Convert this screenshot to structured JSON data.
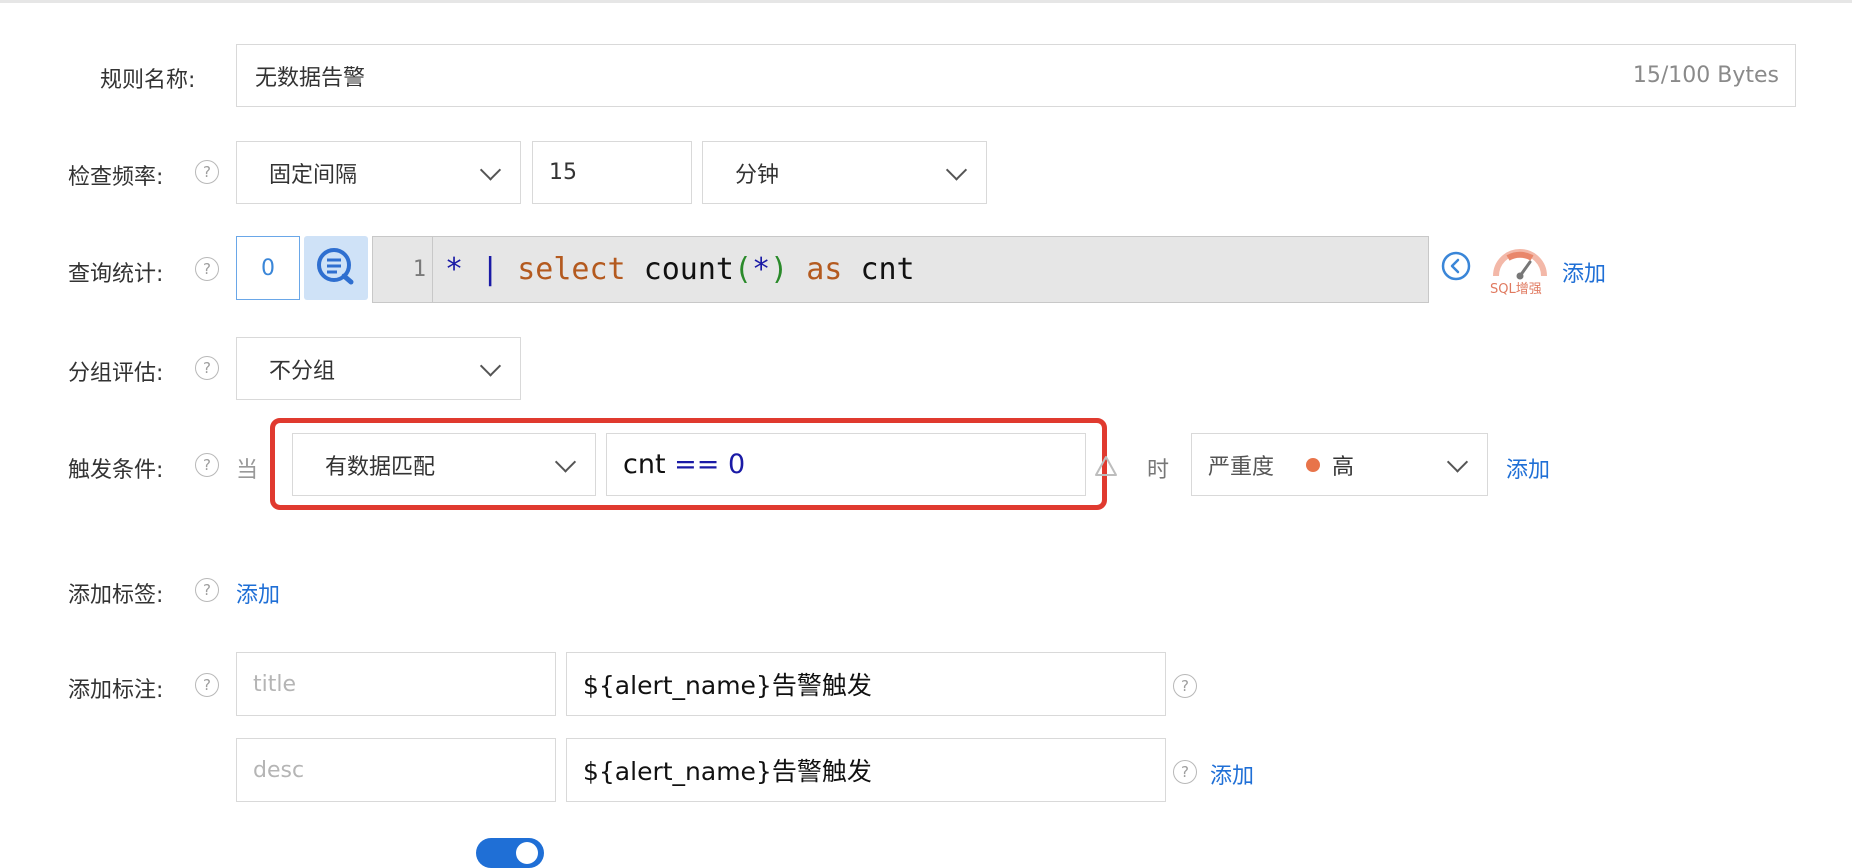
{
  "rule_name": {
    "label": "规则名称:",
    "value": "无数据告警",
    "counter": "15/100 Bytes"
  },
  "check_frequency": {
    "label": "检查频率:",
    "mode": "固定间隔",
    "interval": "15",
    "unit": "分钟"
  },
  "query": {
    "label": "查询统计:",
    "count": "0",
    "line_number": "1",
    "code_tokens": {
      "star": "*",
      "pipe": "|",
      "select": "select",
      "func": "count",
      "lparen": "(",
      "arg": "*",
      "rparen": ")",
      "as": "as",
      "alias": "cnt"
    },
    "sql_badge": "SQL增强",
    "add": "添加"
  },
  "group": {
    "label": "分组评估:",
    "value": "不分组"
  },
  "trigger": {
    "label": "触发条件:",
    "prefix": "当",
    "match_type": "有数据匹配",
    "expr_var": "cnt",
    "expr_op": "==",
    "expr_val": "0",
    "when": "时",
    "severity_label": "严重度",
    "severity_value": "高",
    "severity_color": "#e8744a",
    "add": "添加"
  },
  "labels": {
    "label": "添加标签:",
    "add": "添加"
  },
  "annotations": {
    "label": "添加标注:",
    "rows": [
      {
        "key_placeholder": "title",
        "value": "${alert_name}告警触发"
      },
      {
        "key_placeholder": "desc",
        "value": "${alert_name}告警触发"
      }
    ],
    "add": "添加"
  },
  "colors": {
    "accent": "#1f6fd6",
    "highlight": "#e03a2f",
    "toggle": "#1f6fd6"
  }
}
